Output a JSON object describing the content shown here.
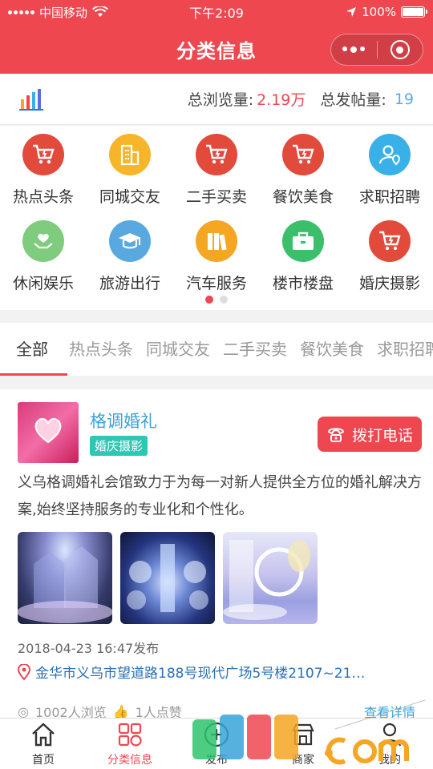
{
  "status_bar": {
    "carrier": "中国移动",
    "time": "下午2:09",
    "battery": "100%"
  },
  "nav": {
    "title": "分类信息"
  },
  "stats": {
    "views_label": "总浏览量:",
    "views_value": "2.19万",
    "posts_label": "总发帖量:",
    "posts_value": "19"
  },
  "categories": [
    {
      "label": "热点头条",
      "color": "#e24a3b",
      "icon": "cart-icon"
    },
    {
      "label": "同城交友",
      "color": "#f7b52a",
      "icon": "building-icon"
    },
    {
      "label": "二手买卖",
      "color": "#e24a3b",
      "icon": "cart-icon"
    },
    {
      "label": "餐饮美食",
      "color": "#e24a3b",
      "icon": "cart-icon"
    },
    {
      "label": "求职招聘",
      "color": "#3ab0e8",
      "icon": "person-pin-icon"
    },
    {
      "label": "休闲娱乐",
      "color": "#7fcc7e",
      "icon": "hand-heart-icon"
    },
    {
      "label": "旅游出行",
      "color": "#5aa8e0",
      "icon": "graduation-cap-icon"
    },
    {
      "label": "汽车服务",
      "color": "#f5a623",
      "icon": "books-icon"
    },
    {
      "label": "楼市楼盘",
      "color": "#3bbf6b",
      "icon": "briefcase-icon"
    },
    {
      "label": "婚庆摄影",
      "color": "#e24a3b",
      "icon": "cart-icon"
    }
  ],
  "tabs": [
    "全部",
    "热点头条",
    "同城交友",
    "二手买卖",
    "餐饮美食",
    "求职招聘"
  ],
  "post": {
    "name": "格调婚礼",
    "tag": "婚庆摄影",
    "call_label": "拨打电话",
    "description": "义乌格调婚礼会馆致力于为每一对新人提供全方位的婚礼解决方案,始终坚持服务的专业化和个性化。",
    "date": "2018-04-23 16:47发布",
    "address": "金华市义乌市望道路188号现代广场5号楼2107~21…",
    "views": "1002人浏览",
    "likes": "1人点赞",
    "more": "查看详情"
  },
  "tabbar": [
    "首页",
    "分类信息",
    "发布",
    "商家",
    "我的"
  ],
  "colors": {
    "primary": "#ee4750",
    "link": "#3aa3d8",
    "tag": "#2ec6b4"
  }
}
